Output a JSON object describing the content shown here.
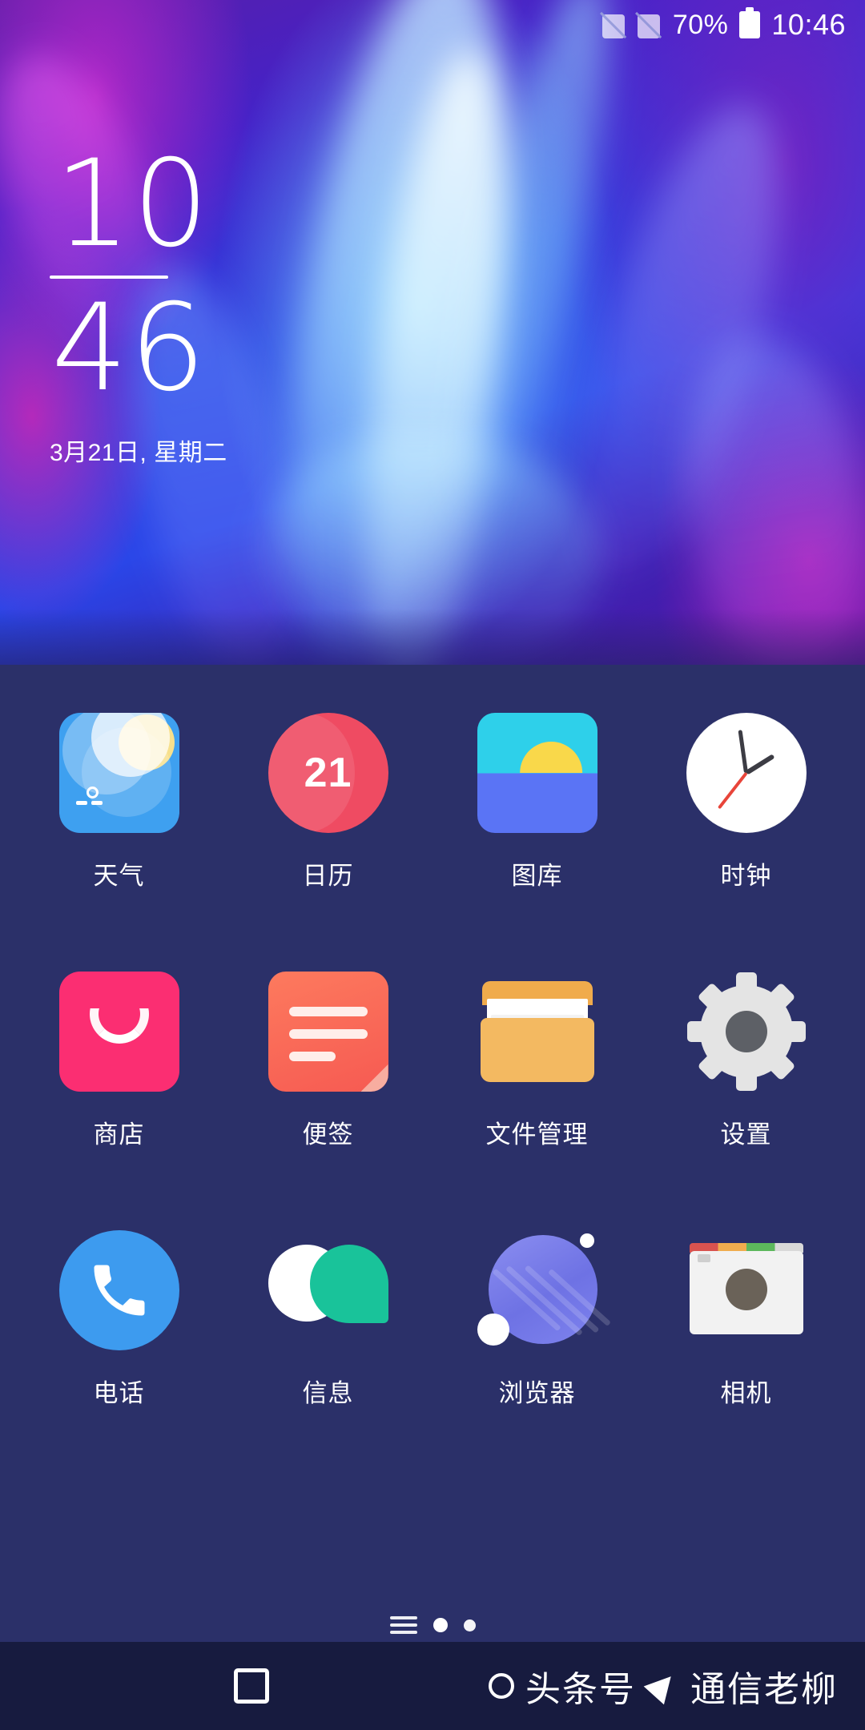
{
  "status_bar": {
    "signal_icons": [
      "signal-off-icon",
      "signal-off-icon"
    ],
    "battery_percent": "70%",
    "battery_icon": "battery-icon",
    "time": "10:46"
  },
  "clock_widget": {
    "hour": "10",
    "minute": "46",
    "date": "3月21日, 星期二"
  },
  "home": {
    "background_color": "#2b3069",
    "rows": [
      {
        "apps": [
          {
            "label": "天气",
            "icon": "weather-icon",
            "color": "#3ea0f0"
          },
          {
            "label": "日历",
            "icon": "calendar-icon",
            "color": "#ef4b62",
            "badge": "21"
          },
          {
            "label": "图库",
            "icon": "gallery-icon",
            "color": "#2ed0ea"
          },
          {
            "label": "时钟",
            "icon": "clock-icon",
            "color": "#ffffff"
          }
        ]
      },
      {
        "apps": [
          {
            "label": "商店",
            "icon": "store-icon",
            "color": "#fb2e72"
          },
          {
            "label": "便签",
            "icon": "notes-icon",
            "color": "#f65a52"
          },
          {
            "label": "文件管理",
            "icon": "file-manager-icon",
            "color": "#f3b961"
          },
          {
            "label": "设置",
            "icon": "settings-gear-icon",
            "color": "#e2e2e2"
          }
        ]
      },
      {
        "apps": [
          {
            "label": "电话",
            "icon": "phone-icon",
            "color": "#3d9bef"
          },
          {
            "label": "信息",
            "icon": "messages-icon",
            "color": "#19c39a"
          },
          {
            "label": "浏览器",
            "icon": "browser-icon",
            "color": "#7e83ee"
          },
          {
            "label": "相机",
            "icon": "camera-icon",
            "color": "#f2f2f2"
          }
        ]
      }
    ]
  },
  "page_indicator": {
    "menu_icon": "app-drawer-lines-icon",
    "dots": 2,
    "active_index": 0
  },
  "nav_bar": {
    "home_icon": "home-square-icon"
  },
  "watermark": {
    "circle_icon": "circle-icon",
    "text1": "头条号",
    "arrow_icon": "send-arrow-icon",
    "text2": "通信老柳"
  }
}
